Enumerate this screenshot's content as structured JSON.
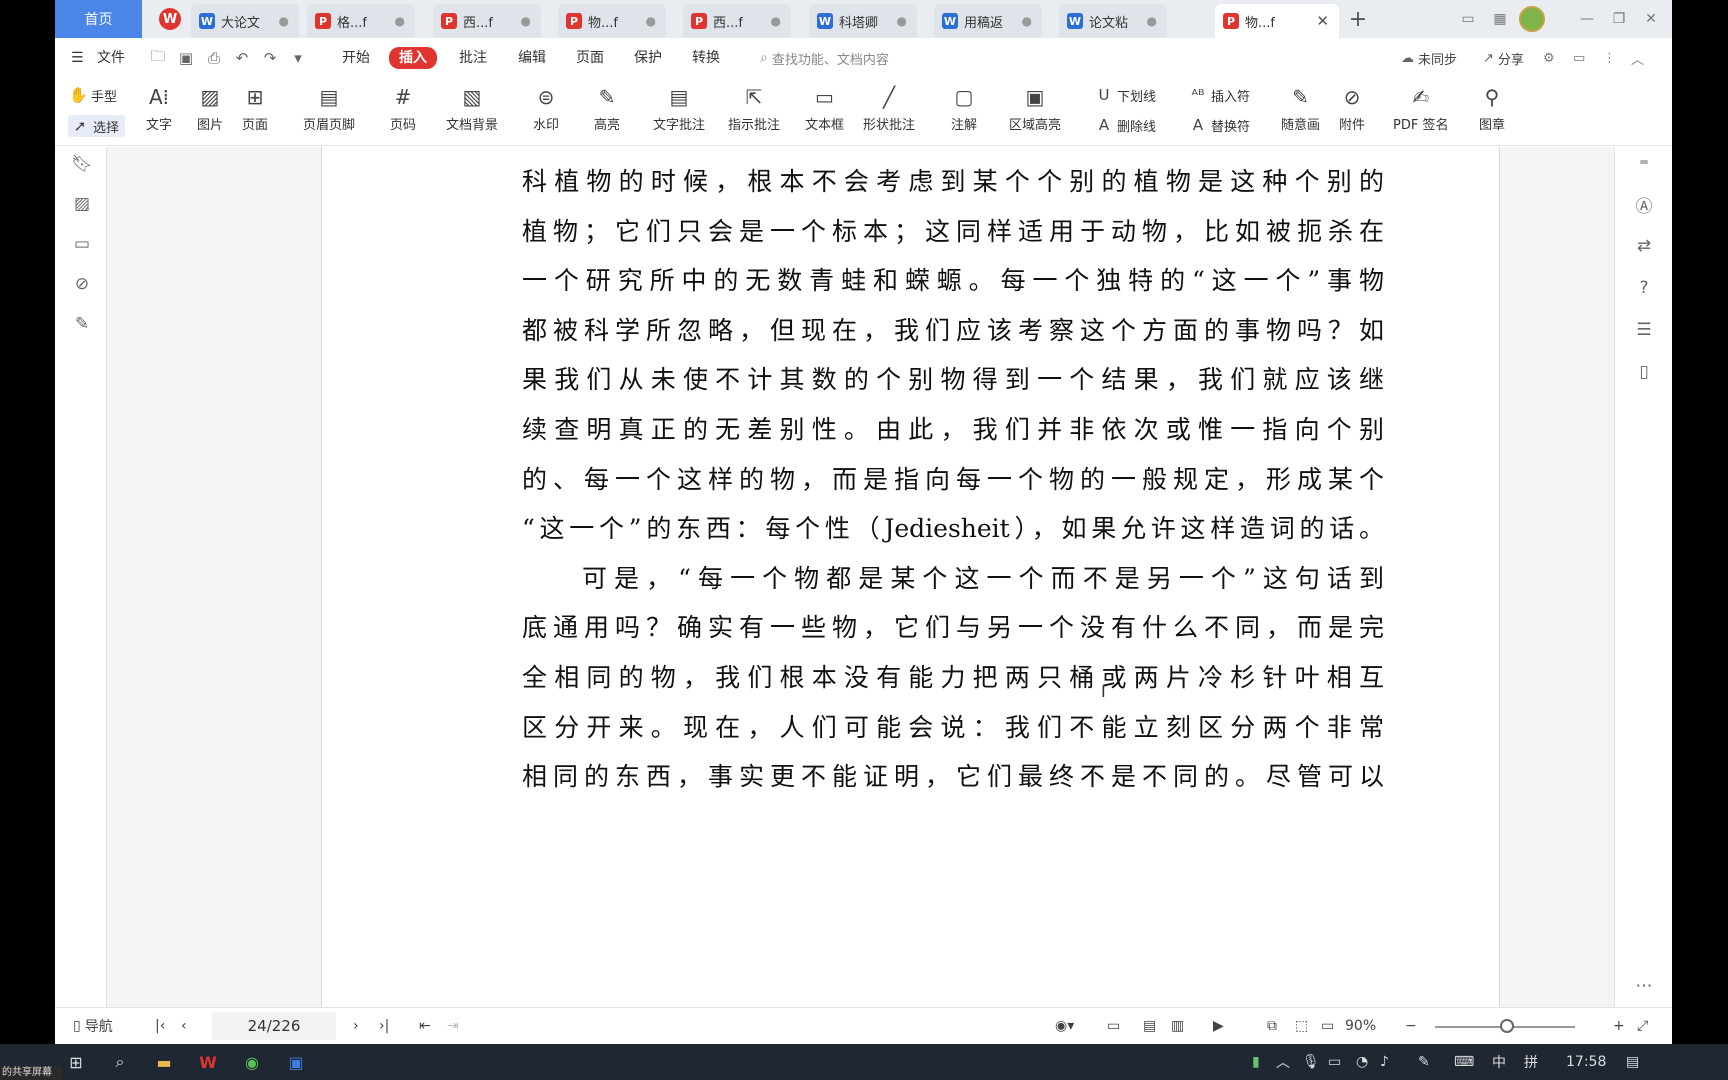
{
  "tabs": {
    "home": "首页",
    "docs": [
      {
        "label": "大论文",
        "kind": "w"
      },
      {
        "label": "格...f",
        "kind": "p"
      },
      {
        "label": "西...f",
        "kind": "p"
      },
      {
        "label": "物...f",
        "kind": "p"
      },
      {
        "label": "西...f",
        "kind": "p"
      },
      {
        "label": "科塔卿",
        "kind": "w"
      },
      {
        "label": "用稿返",
        "kind": "w"
      },
      {
        "label": "论文粘",
        "kind": "w"
      },
      {
        "label": "物...f",
        "kind": "p"
      }
    ],
    "new_tab": "+"
  },
  "menu": {
    "file": "文件",
    "items": [
      "开始",
      "插入",
      "批注",
      "编辑",
      "页面",
      "保护",
      "转换"
    ],
    "active": "插入",
    "search_placeholder": "查找功能、文档内容",
    "sync": "未同步",
    "share": "分享"
  },
  "ribbon": {
    "hand": "手型",
    "select": "选择",
    "buttons": [
      "文字",
      "图片",
      "页面",
      "页眉页脚",
      "页码",
      "文档背景",
      "水印",
      "高亮",
      "文字批注",
      "指示批注",
      "文本框",
      "形状批注",
      "注解",
      "区域高亮"
    ],
    "underline": "下划线",
    "strikethrough": "删除线",
    "insert_mark": "插入符",
    "replace_mark": "替换符",
    "freehand": "随意画",
    "attachment": "附件",
    "pdf_sign": "PDF 签名",
    "stamp": "图章"
  },
  "document": {
    "lines": [
      {
        "text": "科植物的时候，根本不会考虑到某个个别的植物是这种个别的",
        "indent": false
      },
      {
        "text": "植物；它们只会是一个标本；这同样适用于动物，比如被扼杀在",
        "indent": false
      },
      {
        "text": "一个研究所中的无数青蛙和蝾螈。每一个独特的“这一个”事物",
        "indent": false
      },
      {
        "text": "都被科学所忽略，但现在，我们应该考察这个方面的事物吗？如",
        "indent": false
      },
      {
        "text": "果我们从未使不计其数的个别物得到一个结果，我们就应该继",
        "indent": false
      },
      {
        "text": "续查明真正的无差别性。由此，我们并非依次或惟一指向个别",
        "indent": false
      },
      {
        "text": "的、每一个这样的物，而是指向每一个物的一般规定，形成某个",
        "indent": false
      },
      {
        "text": "“这一个”的东西：每个性（Jediesheit），如果允许这样造词的话。",
        "indent": false
      },
      {
        "text": "可是，“每一个物都是某个这一个而不是另一个”这句话到",
        "indent": true
      },
      {
        "text": "底通用吗？确实有一些物，它们与另一个没有什么不同，而是完",
        "indent": false
      },
      {
        "text": "全相同的物，我们根本没有能力把两只桶或两片冷杉针叶相互",
        "indent": false
      },
      {
        "text": "区分开来。现在，人们可能会说：我们不能立刻区分两个非常",
        "indent": false
      },
      {
        "text": "相同的东西，事实更不能证明，它们最终不是不同的。尽管可以",
        "indent": false
      }
    ]
  },
  "status": {
    "nav": "导航",
    "page_indicator": "24/226",
    "zoom": "90%"
  },
  "taskbar": {
    "share_label": "的共享屏幕",
    "ime": "中",
    "ime2": "拼",
    "time": "17:58"
  }
}
